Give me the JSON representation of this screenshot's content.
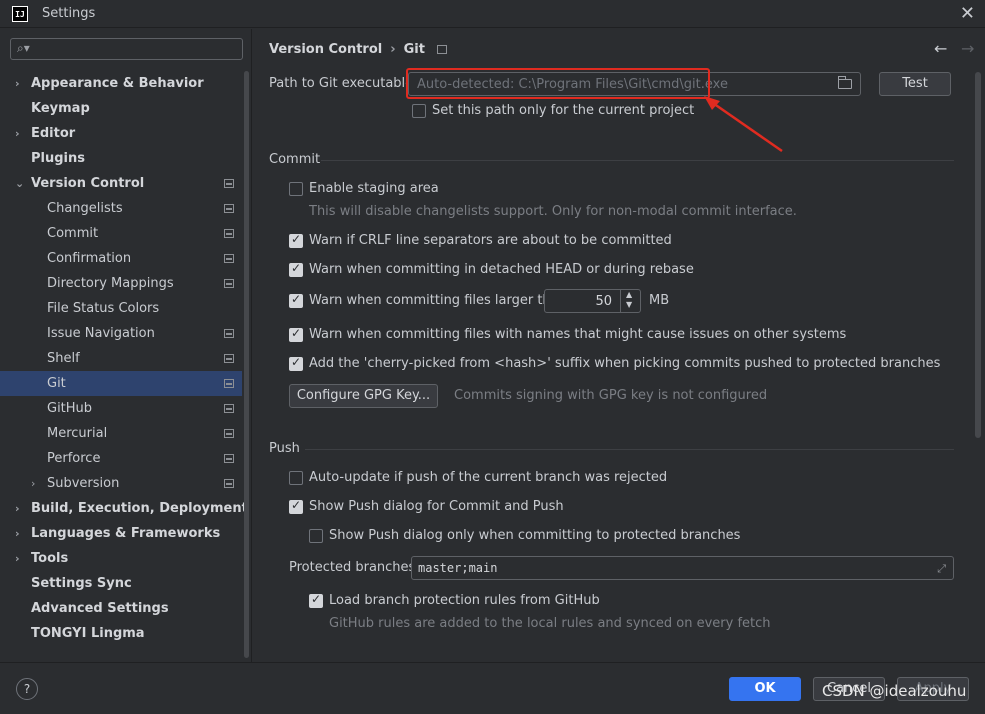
{
  "window": {
    "title": "Settings",
    "app_icon_text": "IJ"
  },
  "search": {
    "placeholder": ""
  },
  "sidebar": {
    "items": [
      {
        "label": "Appearance & Behavior",
        "level": "top",
        "expandable": true,
        "expanded": false,
        "project": false
      },
      {
        "label": "Keymap",
        "level": "top",
        "expandable": false,
        "project": false
      },
      {
        "label": "Editor",
        "level": "top",
        "expandable": true,
        "expanded": false,
        "project": false
      },
      {
        "label": "Plugins",
        "level": "top",
        "expandable": false,
        "project": false
      },
      {
        "label": "Version Control",
        "level": "top",
        "expandable": true,
        "expanded": true,
        "project": true
      },
      {
        "label": "Changelists",
        "level": "sub",
        "project": true
      },
      {
        "label": "Commit",
        "level": "sub",
        "project": true
      },
      {
        "label": "Confirmation",
        "level": "sub",
        "project": true
      },
      {
        "label": "Directory Mappings",
        "level": "sub",
        "project": true
      },
      {
        "label": "File Status Colors",
        "level": "sub",
        "project": false
      },
      {
        "label": "Issue Navigation",
        "level": "sub",
        "project": true
      },
      {
        "label": "Shelf",
        "level": "sub",
        "project": true
      },
      {
        "label": "Git",
        "level": "sub",
        "project": true,
        "selected": true
      },
      {
        "label": "GitHub",
        "level": "sub",
        "project": true
      },
      {
        "label": "Mercurial",
        "level": "sub",
        "project": true
      },
      {
        "label": "Perforce",
        "level": "sub",
        "project": true
      },
      {
        "label": "Subversion",
        "level": "sub",
        "expandable": true,
        "expanded": false,
        "project": true
      },
      {
        "label": "Build, Execution, Deployment",
        "level": "top",
        "expandable": true,
        "expanded": false,
        "project": false
      },
      {
        "label": "Languages & Frameworks",
        "level": "top",
        "expandable": true,
        "expanded": false,
        "project": false
      },
      {
        "label": "Tools",
        "level": "top",
        "expandable": true,
        "expanded": false,
        "project": false
      },
      {
        "label": "Settings Sync",
        "level": "top",
        "expandable": false,
        "project": false
      },
      {
        "label": "Advanced Settings",
        "level": "top",
        "expandable": false,
        "project": false
      },
      {
        "label": "TONGYI Lingma",
        "level": "top",
        "expandable": false,
        "project": false
      }
    ]
  },
  "breadcrumb": {
    "parent": "Version Control",
    "current": "Git"
  },
  "git": {
    "path_label": "Path to Git executable:",
    "path_placeholder": "Auto-detected: C:\\Program Files\\Git\\cmd\\git.exe",
    "test_label": "Test",
    "path_only_project": "Set this path only for the current project"
  },
  "commit": {
    "title": "Commit",
    "staging": "Enable staging area",
    "staging_hint": "This will disable changelists support. Only for non-modal commit interface.",
    "crlf": "Warn if CRLF line separators are about to be committed",
    "detached": "Warn when committing in detached HEAD or during rebase",
    "larger_than": "Warn when committing files larger than",
    "size_value": "50",
    "size_unit": "MB",
    "names_issue": "Warn when committing files with names that might cause issues on other systems",
    "cherry_pick": "Add the 'cherry-picked from <hash>' suffix when picking commits pushed to protected branches",
    "gpg_button": "Configure GPG Key...",
    "gpg_hint": "Commits signing with GPG key is not configured"
  },
  "push": {
    "title": "Push",
    "auto_update": "Auto-update if push of the current branch was rejected",
    "show_dialog": "Show Push dialog for Commit and Push",
    "show_dialog_protected": "Show Push dialog only when committing to protected branches",
    "protected_label": "Protected branches:",
    "protected_value": "master;main",
    "load_rules": "Load branch protection rules from GitHub",
    "load_rules_hint": "GitHub rules are added to the local rules and synced on every fetch"
  },
  "footer": {
    "help": "?",
    "ok": "OK",
    "cancel": "Cancel",
    "apply": "Apply"
  },
  "watermark": "CSDN @idealzouhu",
  "colors": {
    "accent": "#3574f0",
    "selection": "#2e436e",
    "highlight": "#e02b20"
  }
}
